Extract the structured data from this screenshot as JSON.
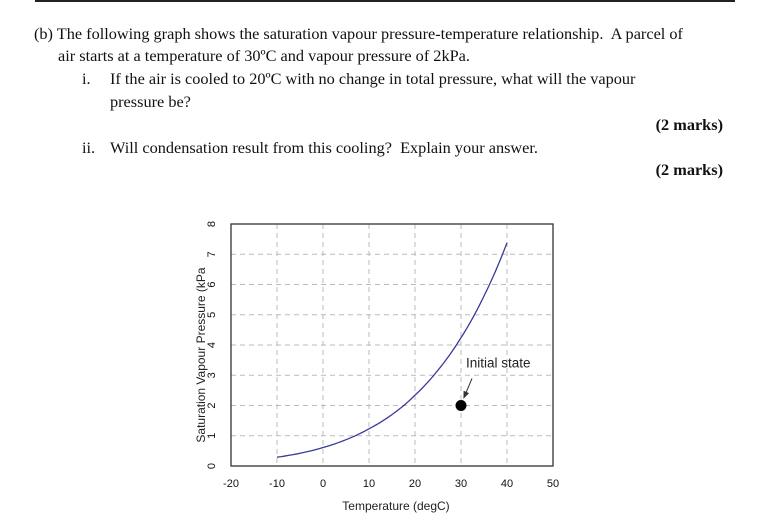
{
  "question": {
    "part_label": "(b)",
    "intro_line1": "The following graph shows the saturation vapour pressure-temperature relationship.  A parcel of",
    "intro_line2": "air starts at a temperature of 30ºC and vapour pressure of 2kPa.",
    "items": [
      {
        "label": "i.",
        "text_line1": "If the air is cooled to 20ºC with no change in total pressure, what will the vapour",
        "text_line2": "pressure be?",
        "marks": "(2 marks)"
      },
      {
        "label": "ii.",
        "text_line1": "Will condensation result from this cooling?  Explain your answer.",
        "marks": "(2 marks)"
      }
    ]
  },
  "chart_data": {
    "type": "line",
    "title": "",
    "xlabel": "Temperature (degC)",
    "ylabel": "Saturation Vapour Pressure (kPa",
    "xlim": [
      -20,
      50
    ],
    "ylim": [
      0,
      8
    ],
    "xticks": [
      "-20",
      "-10",
      "0",
      "10",
      "20",
      "30",
      "40",
      "50"
    ],
    "yticks": [
      "0",
      "1",
      "2",
      "3",
      "4",
      "5",
      "6",
      "7",
      "8"
    ],
    "grid": true,
    "legend": "none",
    "series": [
      {
        "name": "Saturation vapour pressure",
        "color": "#3a3a9a",
        "x": [
          -10,
          -5,
          0,
          5,
          10,
          15,
          20,
          25,
          30,
          35,
          40
        ],
        "y": [
          0.29,
          0.42,
          0.61,
          0.87,
          1.23,
          1.7,
          2.34,
          3.17,
          4.24,
          5.62,
          7.38
        ]
      }
    ],
    "points": [
      {
        "name": "Initial state",
        "x": 30,
        "y": 2,
        "color": "#000000"
      }
    ],
    "annotations": [
      {
        "text": "Initial state",
        "points_to": {
          "x": 30,
          "y": 2
        }
      }
    ]
  }
}
